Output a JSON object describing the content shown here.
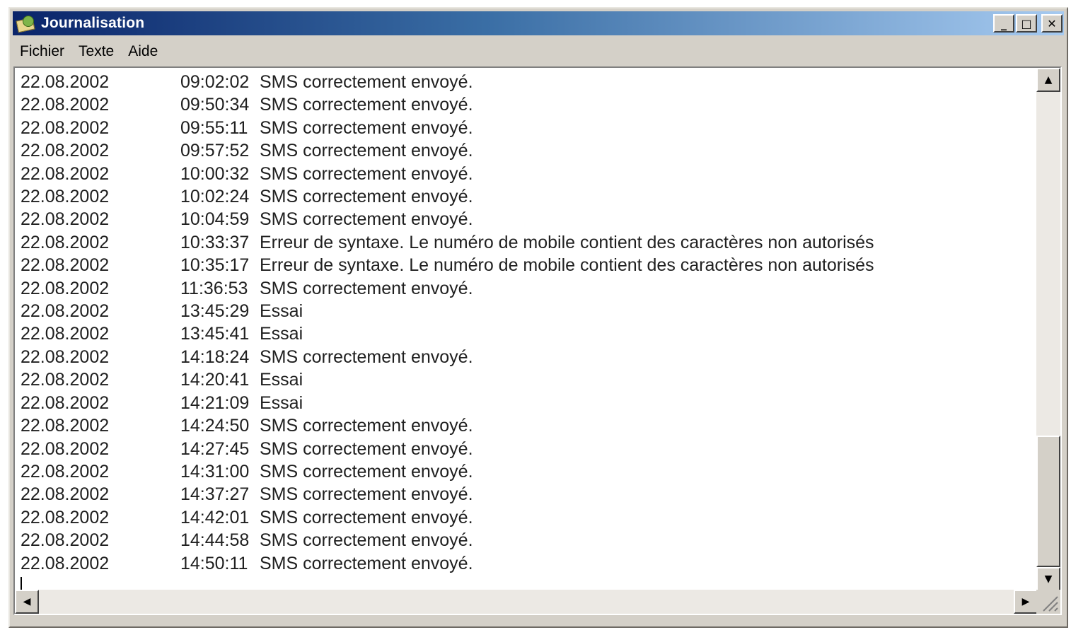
{
  "window": {
    "title": "Journalisation",
    "icon": "mail-envelope-icon"
  },
  "caption_buttons": {
    "minimize": "_",
    "maximize": "□",
    "close": "✕"
  },
  "menu": [
    "Fichier",
    "Texte",
    "Aide"
  ],
  "log": [
    {
      "date": "22.08.2002",
      "time": "09:02:02",
      "message": "SMS correctement envoyé."
    },
    {
      "date": "22.08.2002",
      "time": "09:50:34",
      "message": "SMS correctement envoyé."
    },
    {
      "date": "22.08.2002",
      "time": "09:55:11",
      "message": "SMS correctement envoyé."
    },
    {
      "date": "22.08.2002",
      "time": "09:57:52",
      "message": "SMS correctement envoyé."
    },
    {
      "date": "22.08.2002",
      "time": "10:00:32",
      "message": "SMS correctement envoyé."
    },
    {
      "date": "22.08.2002",
      "time": "10:02:24",
      "message": "SMS correctement envoyé."
    },
    {
      "date": "22.08.2002",
      "time": "10:04:59",
      "message": "SMS correctement envoyé."
    },
    {
      "date": "22.08.2002",
      "time": "10:33:37",
      "message": "Erreur de syntaxe. Le numéro de mobile contient des caractères non autorisés"
    },
    {
      "date": "22.08.2002",
      "time": "10:35:17",
      "message": "Erreur de syntaxe. Le numéro de mobile contient des caractères non autorisés"
    },
    {
      "date": "22.08.2002",
      "time": "11:36:53",
      "message": "SMS correctement envoyé."
    },
    {
      "date": "22.08.2002",
      "time": "13:45:29",
      "message": "Essai"
    },
    {
      "date": "22.08.2002",
      "time": "13:45:41",
      "message": "Essai"
    },
    {
      "date": "22.08.2002",
      "time": "14:18:24",
      "message": "SMS correctement envoyé."
    },
    {
      "date": "22.08.2002",
      "time": "14:20:41",
      "message": "Essai"
    },
    {
      "date": "22.08.2002",
      "time": "14:21:09",
      "message": "Essai"
    },
    {
      "date": "22.08.2002",
      "time": "14:24:50",
      "message": "SMS correctement envoyé."
    },
    {
      "date": "22.08.2002",
      "time": "14:27:45",
      "message": "SMS correctement envoyé."
    },
    {
      "date": "22.08.2002",
      "time": "14:31:00",
      "message": "SMS correctement envoyé."
    },
    {
      "date": "22.08.2002",
      "time": "14:37:27",
      "message": "SMS correctement envoyé."
    },
    {
      "date": "22.08.2002",
      "time": "14:42:01",
      "message": "SMS correctement envoyé."
    },
    {
      "date": "22.08.2002",
      "time": "14:44:58",
      "message": "SMS correctement envoyé."
    },
    {
      "date": "22.08.2002",
      "time": "14:50:11",
      "message": "SMS correctement envoyé."
    }
  ],
  "scrollbar": {
    "up_icon": "▲",
    "down_icon": "▼",
    "left_icon": "◀",
    "right_icon": "▶",
    "grip_icon": "resize-grip-icon"
  },
  "colors": {
    "title_gradient_start": "#0a246a",
    "title_gradient_end": "#a6caf0",
    "chrome": "#d4d0c8"
  }
}
